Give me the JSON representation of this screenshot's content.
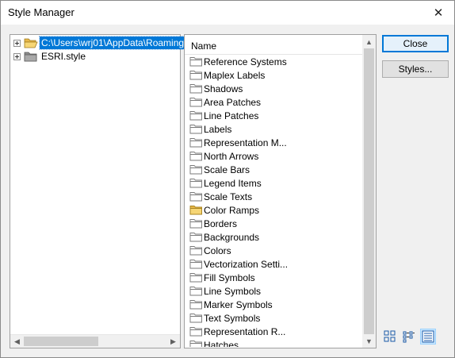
{
  "window": {
    "title": "Style Manager",
    "close_icon": "close-icon"
  },
  "tree": {
    "items": [
      {
        "label": "C:\\Users\\wrj01\\AppData\\Roaming",
        "selected": true,
        "icon": "open-folder-icon"
      },
      {
        "label": "ESRI.style",
        "selected": false,
        "icon": "folder-icon"
      }
    ]
  },
  "list": {
    "column_header": "Name",
    "items": [
      {
        "label": "Reference Systems",
        "icon": "folder-icon"
      },
      {
        "label": "Maplex Labels",
        "icon": "folder-icon"
      },
      {
        "label": "Shadows",
        "icon": "folder-icon"
      },
      {
        "label": "Area Patches",
        "icon": "folder-icon"
      },
      {
        "label": "Line Patches",
        "icon": "folder-icon"
      },
      {
        "label": "Labels",
        "icon": "folder-icon"
      },
      {
        "label": "Representation M...",
        "icon": "folder-icon"
      },
      {
        "label": "North Arrows",
        "icon": "folder-icon"
      },
      {
        "label": "Scale Bars",
        "icon": "folder-icon"
      },
      {
        "label": "Legend Items",
        "icon": "folder-icon"
      },
      {
        "label": "Scale Texts",
        "icon": "folder-icon"
      },
      {
        "label": "Color Ramps",
        "icon": "filled-folder-icon"
      },
      {
        "label": "Borders",
        "icon": "folder-icon"
      },
      {
        "label": "Backgrounds",
        "icon": "folder-icon"
      },
      {
        "label": "Colors",
        "icon": "folder-icon"
      },
      {
        "label": "Vectorization Setti...",
        "icon": "folder-icon"
      },
      {
        "label": "Fill Symbols",
        "icon": "folder-icon"
      },
      {
        "label": "Line Symbols",
        "icon": "folder-icon"
      },
      {
        "label": "Marker Symbols",
        "icon": "folder-icon"
      },
      {
        "label": "Text Symbols",
        "icon": "folder-icon"
      },
      {
        "label": "Representation R...",
        "icon": "folder-icon"
      },
      {
        "label": "Hatches",
        "icon": "folder-icon"
      }
    ]
  },
  "buttons": {
    "close_label": "Close",
    "styles_label": "Styles..."
  },
  "view_modes": [
    {
      "name": "large-icons-view-icon",
      "active": false
    },
    {
      "name": "list-view-icon",
      "active": false
    },
    {
      "name": "details-view-icon",
      "active": true
    }
  ],
  "colors": {
    "selection": "#0078d7",
    "folder_yellow": "#f3d26b"
  }
}
